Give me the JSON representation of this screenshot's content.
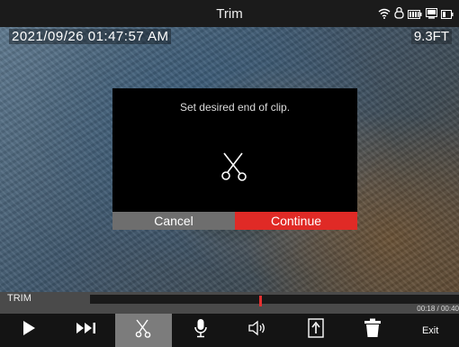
{
  "titlebar": {
    "title": "Trim",
    "status_icons": [
      "wifi-icon",
      "lock-icon",
      "battery-icon",
      "storage-card-icon",
      "battery-alt-icon"
    ]
  },
  "video": {
    "timestamp": "2021/09/26 01:47:57 AM",
    "depth": "9.3FT"
  },
  "dialog": {
    "message": "Set desired end of clip.",
    "icon": "scissors-icon",
    "cancel_label": "Cancel",
    "continue_label": "Continue",
    "colors": {
      "cancel": "#6e6e6e",
      "continue": "#e02a26"
    }
  },
  "timeline": {
    "mode_label": "TRIM",
    "time": "00:18 / 00:40",
    "marker_position": 0.46,
    "marker_color": "#e53030"
  },
  "toolbar": {
    "items": [
      {
        "name": "play-icon",
        "active": false
      },
      {
        "name": "skip-next-icon",
        "active": false
      },
      {
        "name": "scissors-icon",
        "active": true
      },
      {
        "name": "microphone-icon",
        "active": false
      },
      {
        "name": "speaker-icon",
        "active": false
      },
      {
        "name": "export-icon",
        "active": false
      },
      {
        "name": "trash-icon",
        "active": false
      }
    ],
    "exit_label": "Exit"
  }
}
